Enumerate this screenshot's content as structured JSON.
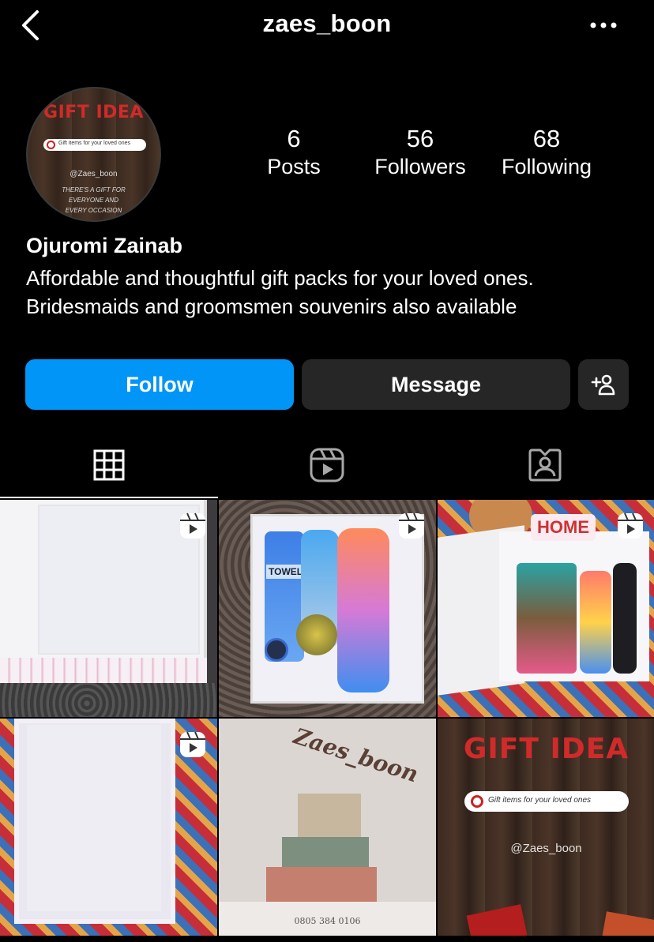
{
  "header": {
    "username": "zaes_boon"
  },
  "avatar": {
    "title": "GIFT IDEA",
    "pill_text": "Gift items for your loved ones",
    "handle": "@Zaes_boon",
    "tagline": "THERE'S A GIFT FOR EVERYONE AND EVERY OCCASION"
  },
  "stats": [
    {
      "value": "6",
      "label": "Posts"
    },
    {
      "value": "56",
      "label": "Followers"
    },
    {
      "value": "68",
      "label": "Following"
    }
  ],
  "profile": {
    "name": "Ojuromi Zainab",
    "bio_line1": "Affordable and thoughtful gift packs for your loved ones.",
    "bio_line2": "Bridesmaids and groomsmen souvenirs also available"
  },
  "actions": {
    "follow": "Follow",
    "message": "Message"
  },
  "tabs": [
    {
      "icon": "grid-icon",
      "active": true
    },
    {
      "icon": "reels-icon",
      "active": false
    },
    {
      "icon": "tagged-icon",
      "active": false
    }
  ],
  "posts": {
    "p2_towel": "TOWEL",
    "p3_sign": "HOME",
    "p5_brand": "Zaes_boon",
    "p5_phone": "0805 384 0106",
    "p6_title": "GIFT IDEA",
    "p6_pill": "Gift items for your loved ones",
    "p6_handle": "@Zaes_boon"
  },
  "colors": {
    "follow_button": "#0095f6",
    "secondary_button": "#262626",
    "brand_red": "#d12a2a"
  }
}
